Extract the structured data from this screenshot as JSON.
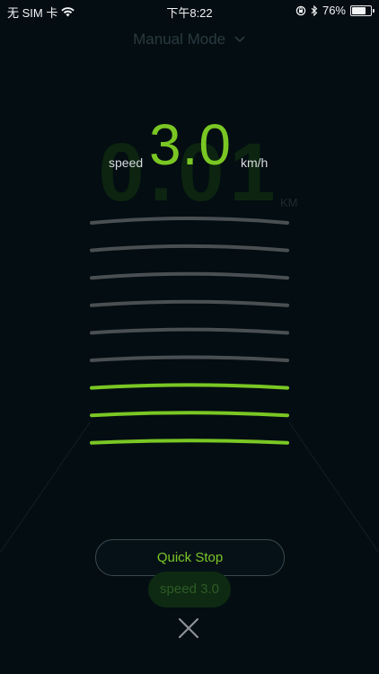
{
  "status_bar": {
    "carrier": "无 SIM 卡",
    "time": "下午8:22",
    "battery_percent_label": "76%",
    "battery_level": 0.76,
    "icons": [
      "wifi-icon",
      "rotation-lock-icon",
      "bluetooth-icon",
      "battery-icon"
    ]
  },
  "background": {
    "mode_label": "Manual Mode",
    "distance_value": "0.01",
    "distance_unit": "KM",
    "speed_pill_label": "speed 3.0"
  },
  "speed_selector": {
    "label": "speed",
    "value": "3.0",
    "unit": "km/h",
    "levels_total": 9,
    "levels_active": 3
  },
  "actions": {
    "quick_stop_label": "Quick Stop",
    "close_icon": "close-icon"
  },
  "colors": {
    "accent": "#7ac724",
    "inactive_arc": "#4a4f52",
    "background": "#030d12"
  }
}
